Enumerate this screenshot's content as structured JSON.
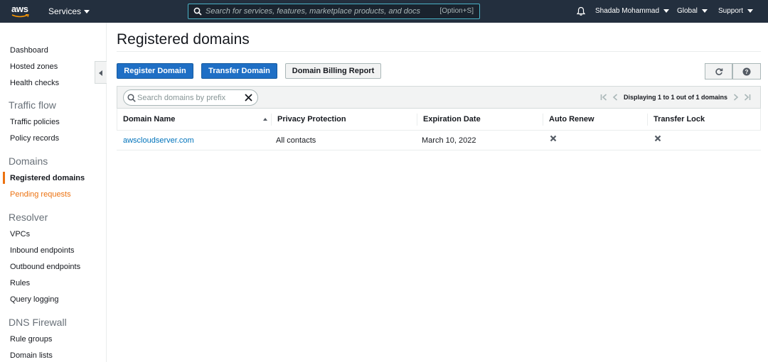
{
  "topnav": {
    "logo": "aws",
    "services_label": "Services",
    "search_placeholder": "Search for services, features, marketplace products, and docs",
    "search_shortcut": "[Option+S]",
    "user": "Shadab Mohammad",
    "region": "Global",
    "support": "Support"
  },
  "sidebar": {
    "items": {
      "dashboard": "Dashboard",
      "hosted_zones": "Hosted zones",
      "health_checks": "Health checks",
      "traffic_policies": "Traffic policies",
      "policy_records": "Policy records",
      "registered_domains": "Registered domains",
      "pending_requests": "Pending requests",
      "vpcs": "VPCs",
      "inbound_endpoints": "Inbound endpoints",
      "outbound_endpoints": "Outbound endpoints",
      "rules": "Rules",
      "query_logging": "Query logging",
      "rule_groups": "Rule groups",
      "domain_lists": "Domain lists"
    },
    "sections": {
      "traffic_flow": "Traffic flow",
      "domains": "Domains",
      "resolver": "Resolver",
      "dns_firewall": "DNS Firewall"
    }
  },
  "main": {
    "title": "Registered domains",
    "buttons": {
      "register": "Register Domain",
      "transfer": "Transfer Domain",
      "billing_report": "Domain Billing Report"
    },
    "filter_placeholder": "Search domains by prefix",
    "pagination_text": "Displaying 1 to 1 out of 1 domains",
    "columns": [
      "Domain Name",
      "Privacy Protection",
      "Expiration Date",
      "Auto Renew",
      "Transfer Lock"
    ],
    "rows": [
      {
        "domain": "awscloudserver.com",
        "privacy": "All contacts",
        "expiration": "March 10, 2022",
        "auto_renew": "disabled",
        "transfer_lock": "disabled"
      }
    ]
  },
  "colors": {
    "nav_bg": "#232f3e",
    "primary_button": "#1f6fc5",
    "accent_orange": "#ec7211",
    "link": "#0073bb"
  }
}
